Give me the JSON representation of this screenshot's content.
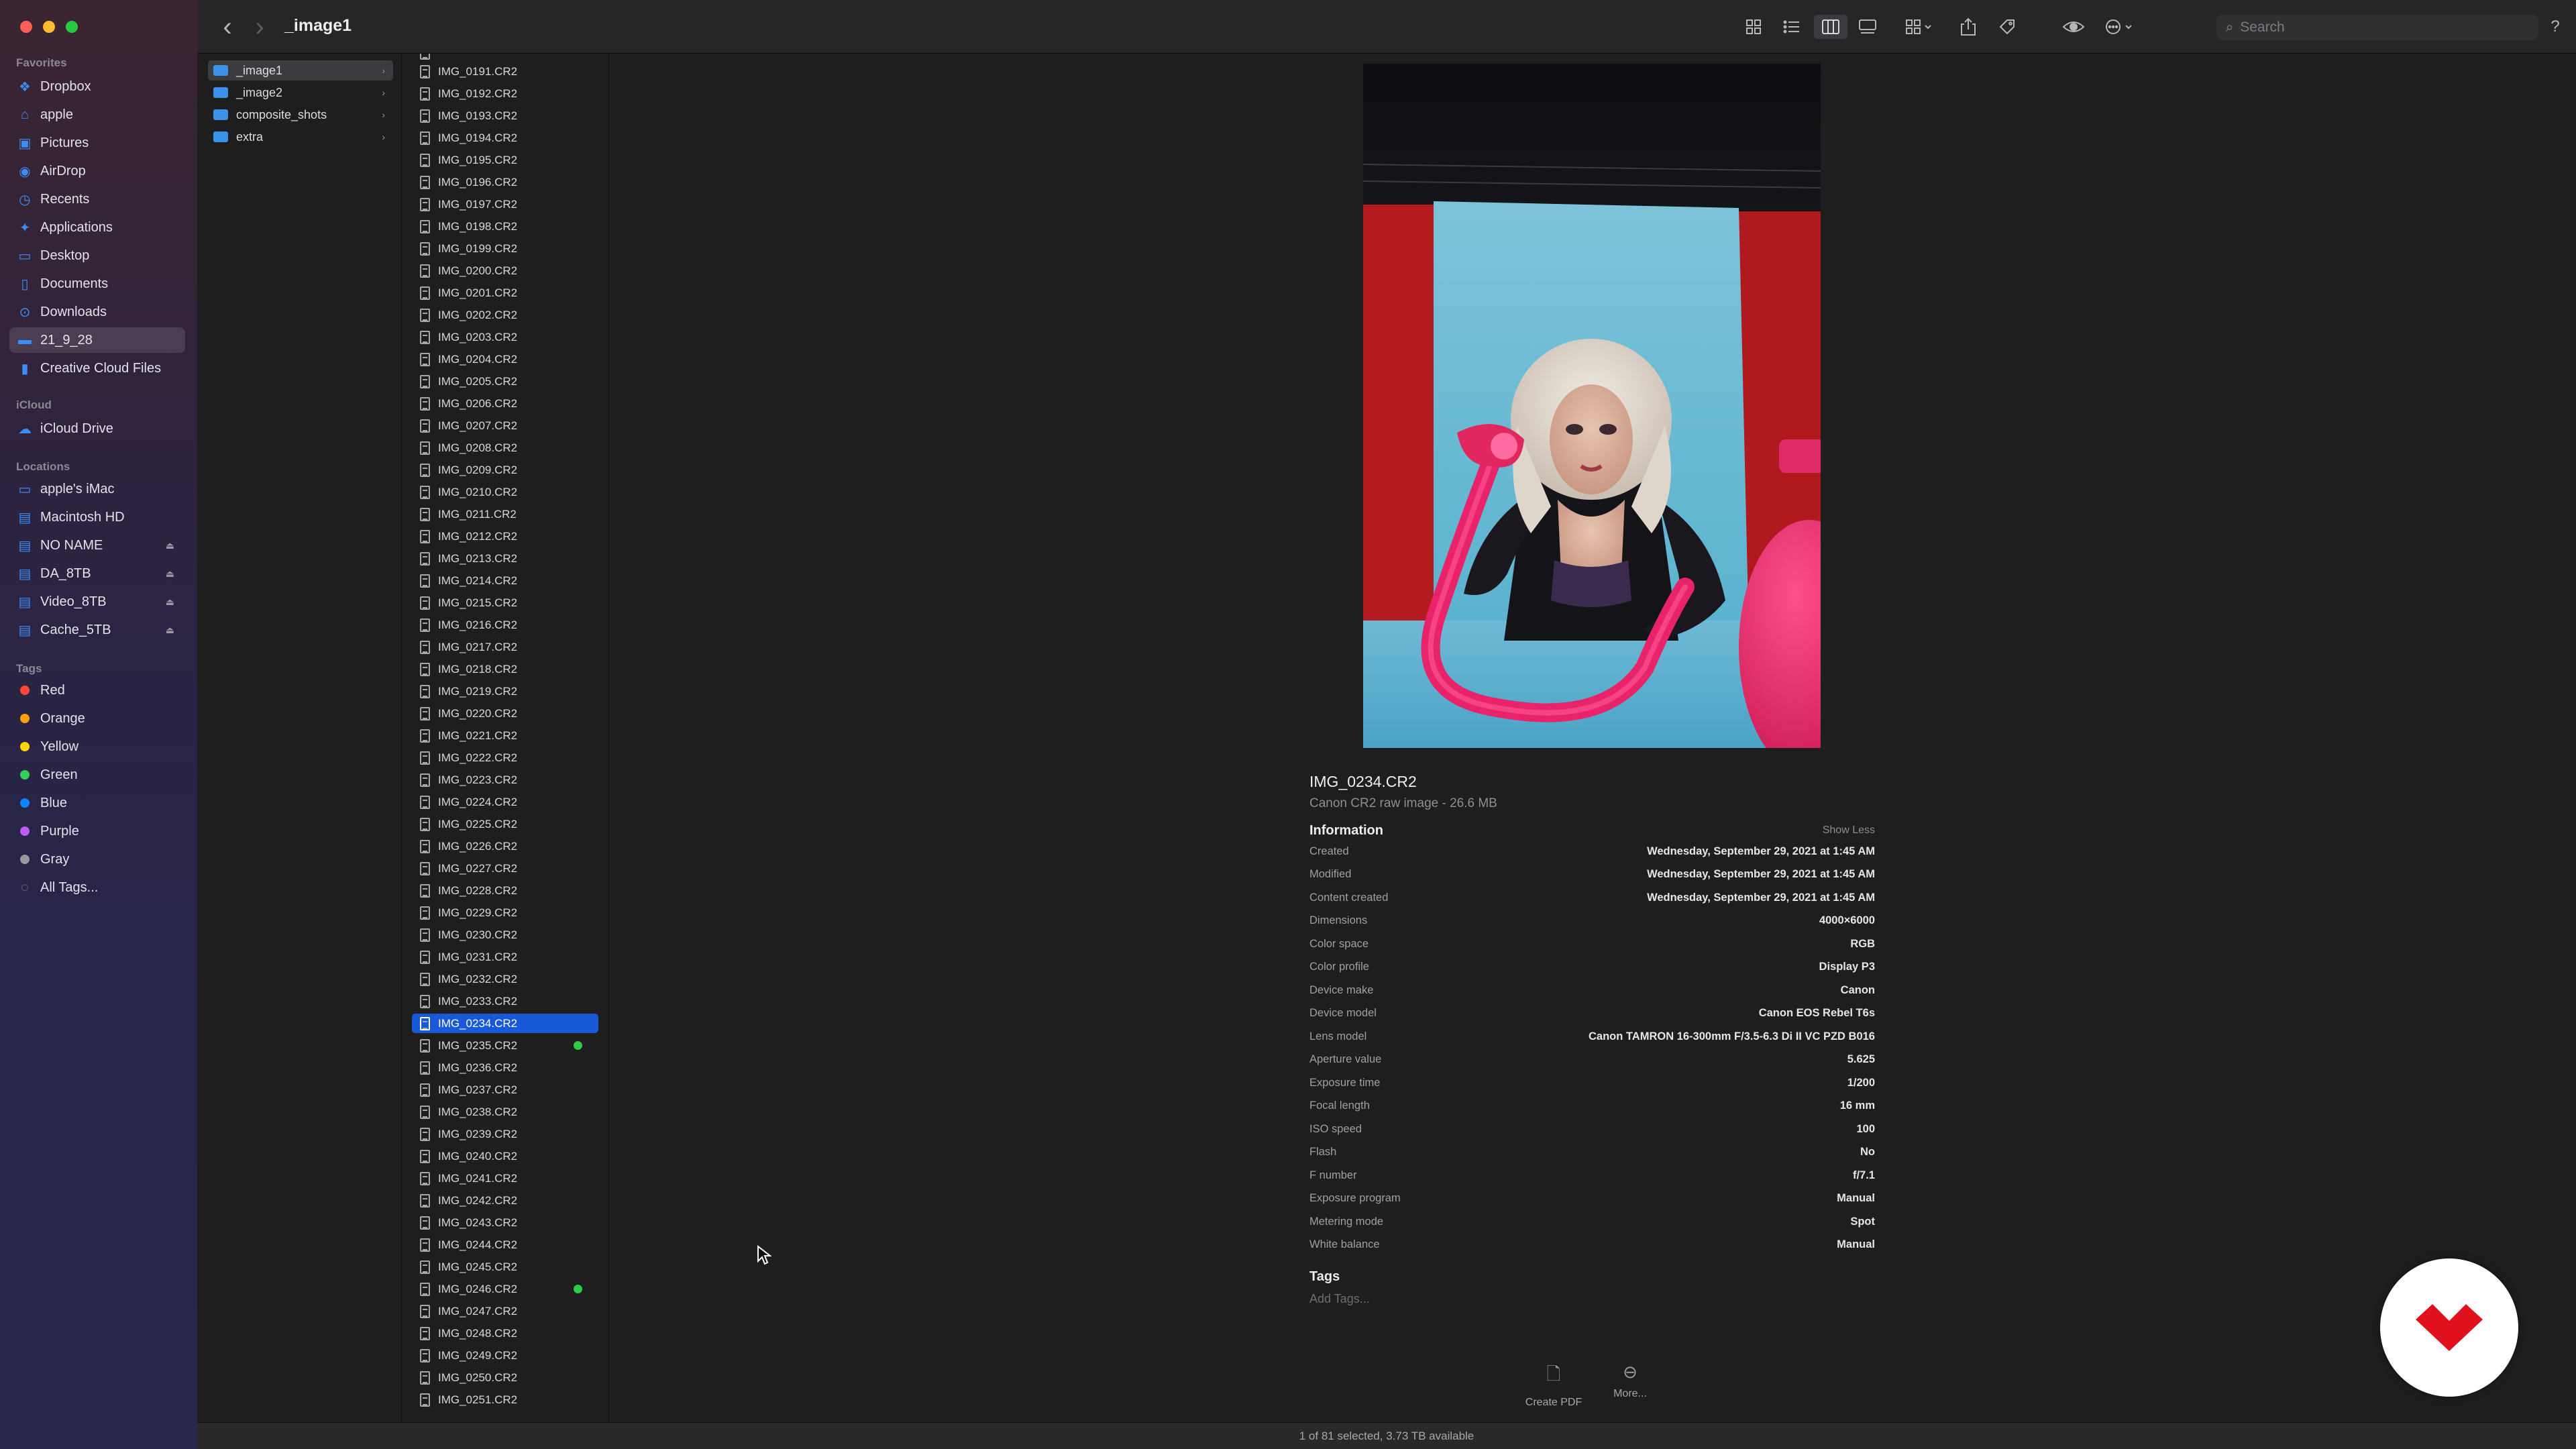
{
  "window": {
    "title": "_image1"
  },
  "sidebar": {
    "favorites_header": "Favorites",
    "favorites": [
      {
        "label": "Dropbox",
        "icon": "dropbox-icon",
        "glyph": "❖"
      },
      {
        "label": "apple",
        "icon": "home-icon",
        "glyph": "⌂"
      },
      {
        "label": "Pictures",
        "icon": "pictures-icon",
        "glyph": "▣"
      },
      {
        "label": "AirDrop",
        "icon": "airdrop-icon",
        "glyph": "◉"
      },
      {
        "label": "Recents",
        "icon": "recents-icon",
        "glyph": "◷"
      },
      {
        "label": "Applications",
        "icon": "applications-icon",
        "glyph": "✦"
      },
      {
        "label": "Desktop",
        "icon": "desktop-icon",
        "glyph": "▭"
      },
      {
        "label": "Documents",
        "icon": "documents-icon",
        "glyph": "▯"
      },
      {
        "label": "Downloads",
        "icon": "downloads-icon",
        "glyph": "⊙"
      },
      {
        "label": "21_9_28",
        "icon": "folder-icon",
        "glyph": "▬"
      },
      {
        "label": "Creative Cloud Files",
        "icon": "creative-cloud-icon",
        "glyph": "▮"
      }
    ],
    "icloud_header": "iCloud",
    "icloud": [
      {
        "label": "iCloud Drive",
        "icon": "icloud-icon",
        "glyph": "☁"
      }
    ],
    "locations_header": "Locations",
    "locations": [
      {
        "label": "apple's iMac",
        "icon": "imac-icon",
        "glyph": "▭",
        "eject": false
      },
      {
        "label": "Macintosh HD",
        "icon": "disk-icon",
        "glyph": "▤",
        "eject": false
      },
      {
        "label": "NO NAME",
        "icon": "disk-icon",
        "glyph": "▤",
        "eject": true
      },
      {
        "label": "DA_8TB",
        "icon": "disk-icon",
        "glyph": "▤",
        "eject": true
      },
      {
        "label": "Video_8TB",
        "icon": "disk-icon",
        "glyph": "▤",
        "eject": true
      },
      {
        "label": "Cache_5TB",
        "icon": "disk-icon",
        "glyph": "▤",
        "eject": true
      }
    ],
    "tags_header": "Tags",
    "tags": [
      {
        "label": "Red",
        "color": "#ff453a"
      },
      {
        "label": "Orange",
        "color": "#ff9f0a"
      },
      {
        "label": "Yellow",
        "color": "#ffd60a"
      },
      {
        "label": "Green",
        "color": "#30d158"
      },
      {
        "label": "Blue",
        "color": "#0a84ff"
      },
      {
        "label": "Purple",
        "color": "#bf5af2"
      },
      {
        "label": "Gray",
        "color": "#98989d"
      },
      {
        "label": "All Tags...",
        "color": ""
      }
    ],
    "eject_glyph": "⏏"
  },
  "toolbar": {
    "back_glyph": "‹",
    "forward_glyph": "›",
    "search_placeholder": "Search",
    "search_glyph": "⌕",
    "help_glyph": "?"
  },
  "folders": [
    {
      "label": "_image1",
      "selected": true
    },
    {
      "label": "_image2",
      "selected": false
    },
    {
      "label": "composite_shots",
      "selected": false
    },
    {
      "label": "extra",
      "selected": false
    }
  ],
  "files": [
    "IMG_0191.CR2",
    "IMG_0192.CR2",
    "IMG_0193.CR2",
    "IMG_0194.CR2",
    "IMG_0195.CR2",
    "IMG_0196.CR2",
    "IMG_0197.CR2",
    "IMG_0198.CR2",
    "IMG_0199.CR2",
    "IMG_0200.CR2",
    "IMG_0201.CR2",
    "IMG_0202.CR2",
    "IMG_0203.CR2",
    "IMG_0204.CR2",
    "IMG_0205.CR2",
    "IMG_0206.CR2",
    "IMG_0207.CR2",
    "IMG_0208.CR2",
    "IMG_0209.CR2",
    "IMG_0210.CR2",
    "IMG_0211.CR2",
    "IMG_0212.CR2",
    "IMG_0213.CR2",
    "IMG_0214.CR2",
    "IMG_0215.CR2",
    "IMG_0216.CR2",
    "IMG_0217.CR2",
    "IMG_0218.CR2",
    "IMG_0219.CR2",
    "IMG_0220.CR2",
    "IMG_0221.CR2",
    "IMG_0222.CR2",
    "IMG_0223.CR2",
    "IMG_0224.CR2",
    "IMG_0225.CR2",
    "IMG_0226.CR2",
    "IMG_0227.CR2",
    "IMG_0228.CR2",
    "IMG_0229.CR2",
    "IMG_0230.CR2",
    "IMG_0231.CR2",
    "IMG_0232.CR2",
    "IMG_0233.CR2",
    "IMG_0234.CR2",
    "IMG_0235.CR2",
    "IMG_0236.CR2",
    "IMG_0237.CR2",
    "IMG_0238.CR2",
    "IMG_0239.CR2",
    "IMG_0240.CR2",
    "IMG_0241.CR2",
    "IMG_0242.CR2",
    "IMG_0243.CR2",
    "IMG_0244.CR2",
    "IMG_0245.CR2",
    "IMG_0246.CR2",
    "IMG_0247.CR2",
    "IMG_0248.CR2",
    "IMG_0249.CR2",
    "IMG_0250.CR2",
    "IMG_0251.CR2"
  ],
  "selected_file": "IMG_0234.CR2",
  "green_tagged_files": [
    "IMG_0235.CR2",
    "IMG_0246.CR2"
  ],
  "preview": {
    "file_name": "IMG_0234.CR2",
    "description": "Canon CR2 raw image - 26.6 MB",
    "info_header": "Information",
    "show_less": "Show Less",
    "info": [
      {
        "key": "Created",
        "value": "Wednesday, September 29, 2021 at 1:45 AM"
      },
      {
        "key": "Modified",
        "value": "Wednesday, September 29, 2021 at 1:45 AM"
      },
      {
        "key": "Content created",
        "value": "Wednesday, September 29, 2021 at 1:45 AM"
      },
      {
        "key": "Dimensions",
        "value": "4000×6000"
      },
      {
        "key": "Color space",
        "value": "RGB"
      },
      {
        "key": "Color profile",
        "value": "Display P3"
      },
      {
        "key": "Device make",
        "value": "Canon"
      },
      {
        "key": "Device model",
        "value": "Canon EOS Rebel T6s"
      },
      {
        "key": "Lens model",
        "value": "Canon TAMRON 16-300mm F/3.5-6.3 Di II VC PZD B016"
      },
      {
        "key": "Aperture value",
        "value": "5.625"
      },
      {
        "key": "Exposure time",
        "value": "1/200"
      },
      {
        "key": "Focal length",
        "value": "16 mm"
      },
      {
        "key": "ISO speed",
        "value": "100"
      },
      {
        "key": "Flash",
        "value": "No"
      },
      {
        "key": "F number",
        "value": "f/7.1"
      },
      {
        "key": "Exposure program",
        "value": "Manual"
      },
      {
        "key": "Metering mode",
        "value": "Spot"
      },
      {
        "key": "White balance",
        "value": "Manual"
      }
    ],
    "tags_header": "Tags",
    "add_tags": "Add Tags...",
    "actions": [
      {
        "label": "Create PDF",
        "icon": "create-pdf-icon",
        "glyph": "🗋"
      },
      {
        "label": "More...",
        "icon": "more-icon",
        "glyph": "⊖"
      }
    ]
  },
  "status_bar": {
    "text": "1 of 81 selected, 3.73 TB available"
  },
  "colors": {
    "accent": "#1958d6",
    "logo_red": "#e0101c"
  }
}
